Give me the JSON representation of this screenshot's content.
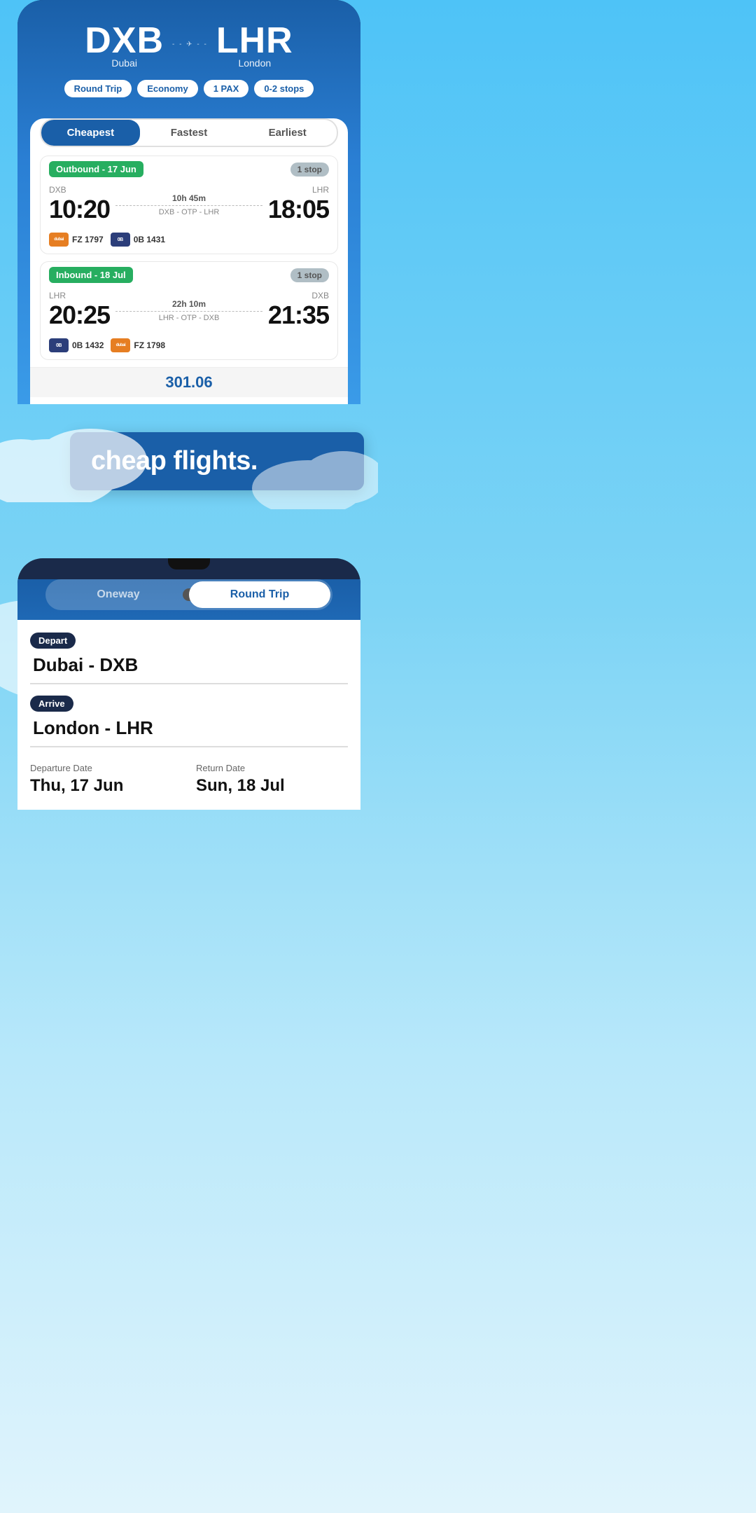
{
  "app": {
    "tagline": "cheap flights."
  },
  "screen_top": {
    "origin_code": "DXB",
    "origin_name": "Dubai",
    "dest_code": "LHR",
    "dest_name": "London",
    "trip_type": "Round Trip",
    "cabin": "Economy",
    "pax": "1 PAX",
    "stops": "0-2 stops",
    "sort_tabs": [
      "Cheapest",
      "Fastest",
      "Earliest"
    ],
    "active_tab": "Cheapest",
    "outbound": {
      "label": "Outbound - 17 Jun",
      "stop_badge": "1 stop",
      "from_airport": "DXB",
      "to_airport": "LHR",
      "depart_time": "10:20",
      "arrive_time": "18:05",
      "duration": "10h 45m",
      "route": "DXB - OTP - LHR",
      "airlines": [
        {
          "code": "FZ 1797",
          "color": "dubai",
          "label": "dubai"
        },
        {
          "code": "0B 1431",
          "color": "blue",
          "label": "0B"
        }
      ]
    },
    "inbound": {
      "label": "Inbound - 18 Jul",
      "stop_badge": "1 stop",
      "from_airport": "LHR",
      "to_airport": "DXB",
      "depart_time": "20:25",
      "arrive_time": "21:35",
      "duration": "22h 10m",
      "route": "LHR - OTP - DXB",
      "airlines": [
        {
          "code": "0B 1432",
          "color": "blue",
          "label": "0B"
        },
        {
          "code": "FZ 1798",
          "color": "dubai",
          "label": "dubai"
        }
      ]
    },
    "price": "301.06"
  },
  "screen_bottom": {
    "trip_options": [
      "Oneway",
      "Round Trip"
    ],
    "active_trip": "Round Trip",
    "depart_label": "Depart",
    "depart_value": "Dubai - DXB",
    "arrive_label": "Arrive",
    "arrive_value": "London - LHR",
    "departure_date_label": "Departure Date",
    "departure_date_value": "Thu, 17 Jun",
    "return_date_label": "Return Date",
    "return_date_value": "Sun, 18 Jul"
  }
}
